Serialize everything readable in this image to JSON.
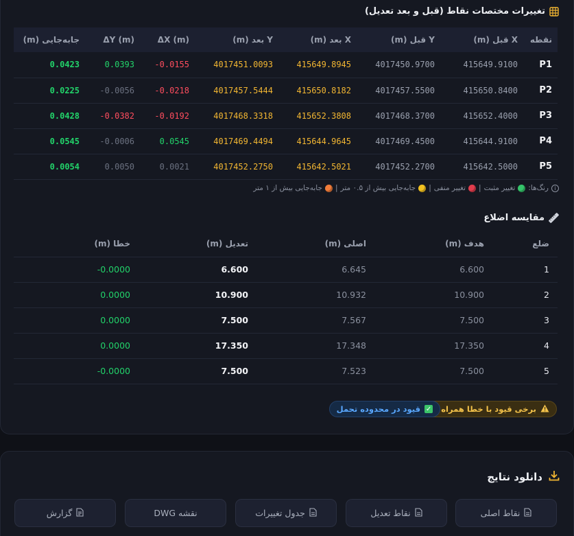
{
  "changes": {
    "title": "تغییرات مختصات نقاط (قبل و بعد تعدیل)",
    "headers": [
      "نقطه",
      "X قبل (m)",
      "Y قبل (m)",
      "X بعد (m)",
      "Y بعد (m)",
      "ΔX (m)",
      "ΔY (m)",
      "جابه‌جایی (m)"
    ],
    "rows": [
      {
        "point": "P1",
        "x_before": "415649.9100",
        "y_before": "4017450.9700",
        "x_after": "415649.8945",
        "y_after": "4017451.0093",
        "dx": "0.0155-",
        "dy": "0.0393",
        "disp": "0.0423",
        "dx_class": "c-neg",
        "dy_class": "c-pos"
      },
      {
        "point": "P2",
        "x_before": "415650.8400",
        "y_before": "4017457.5500",
        "x_after": "415650.8182",
        "y_after": "4017457.5444",
        "dx": "0.0218-",
        "dy": "0.0056-",
        "disp": "0.0225",
        "dx_class": "c-neg",
        "dy_class": "c-small"
      },
      {
        "point": "P3",
        "x_before": "415652.4000",
        "y_before": "4017468.3700",
        "x_after": "415652.3808",
        "y_after": "4017468.3318",
        "dx": "0.0192-",
        "dy": "0.0382-",
        "disp": "0.0428",
        "dx_class": "c-neg",
        "dy_class": "c-neg"
      },
      {
        "point": "P4",
        "x_before": "415644.9100",
        "y_before": "4017469.4500",
        "x_after": "415644.9645",
        "y_after": "4017469.4494",
        "dx": "0.0545",
        "dy": "0.0006-",
        "disp": "0.0545",
        "dx_class": "c-pos",
        "dy_class": "c-small"
      },
      {
        "point": "P5",
        "x_before": "415642.5000",
        "y_before": "4017452.2700",
        "x_after": "415642.5021",
        "y_after": "4017452.2750",
        "dx": "0.0021",
        "dy": "0.0050",
        "disp": "0.0054",
        "dx_class": "c-small",
        "dy_class": "c-small"
      }
    ],
    "legend": {
      "prefix": "رنگ‌ها:",
      "positive": "تغییر مثبت",
      "negative": "تغییر منفی",
      "mid": "جابه‌جایی بیش از ۰.۵ متر",
      "high": "جابه‌جایی بیش از ۱ متر",
      "separator": "|"
    }
  },
  "sides": {
    "title": "مقایسه اضلاع",
    "headers": [
      "ضلع",
      "هدف (m)",
      "اصلی (m)",
      "تعدیل (m)",
      "خطا (m)"
    ],
    "rows": [
      {
        "side": "1",
        "target": "6.600",
        "original": "6.645",
        "adjusted": "6.600",
        "error": "0.0000-"
      },
      {
        "side": "2",
        "target": "10.900",
        "original": "10.932",
        "adjusted": "10.900",
        "error": "0.0000"
      },
      {
        "side": "3",
        "target": "7.500",
        "original": "7.567",
        "adjusted": "7.500",
        "error": "0.0000"
      },
      {
        "side": "4",
        "target": "17.350",
        "original": "17.348",
        "adjusted": "17.350",
        "error": "0.0000"
      },
      {
        "side": "5",
        "target": "7.500",
        "original": "7.523",
        "adjusted": "7.500",
        "error": "0.0000-"
      }
    ]
  },
  "badges": {
    "warning": "برخی قیود با خطا همراه است",
    "ok": "قیود در محدوده تحمل"
  },
  "download": {
    "title": "دانلود نتایج",
    "buttons": [
      "نقاط اصلی",
      "نقاط تعدیل",
      "جدول تغییرات",
      "نقشه DWG",
      "گزارش"
    ]
  },
  "colors": {
    "accent": "#f2b632",
    "positive": "#22d36a",
    "negative": "#ff4d5e",
    "info": "#5aa8ff"
  }
}
